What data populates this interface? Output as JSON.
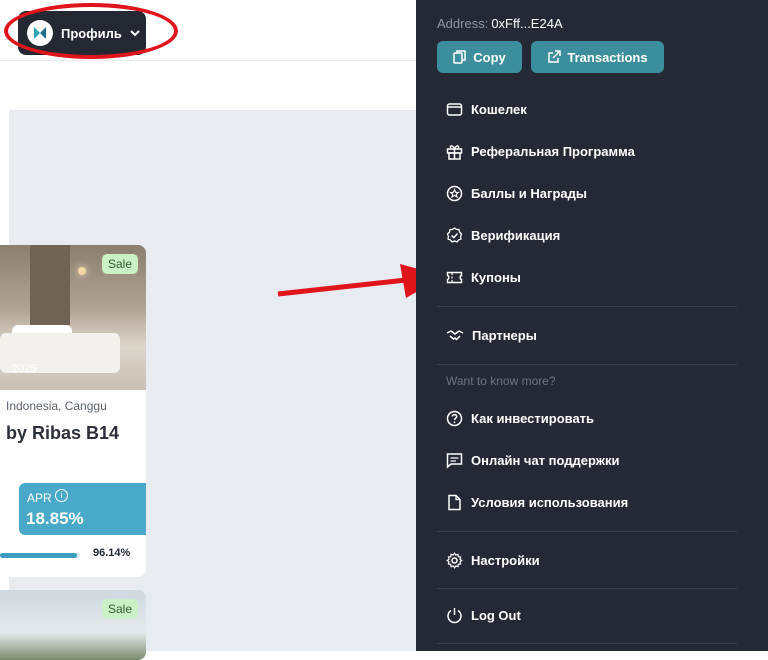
{
  "header": {
    "profile_label": "Профиль"
  },
  "card1": {
    "badge": "Sale",
    "year": "2025",
    "location": "Indonesia, Canggu",
    "title": "by Ribas B14",
    "apr_label": "APR",
    "apr_value": "18.85%",
    "progress_percent": 96.14,
    "progress_text": "96.14%"
  },
  "card2": {
    "badge": "Sale"
  },
  "menu": {
    "address_label": "Address:",
    "address_value": "0xFff...E24A",
    "copy_label": "Copy",
    "transactions_label": "Transactions",
    "items": [
      {
        "label": "Кошелек",
        "icon": "wallet-icon"
      },
      {
        "label": "Реферальная Программа",
        "icon": "gift-icon"
      },
      {
        "label": "Баллы и Награды",
        "icon": "badge-star-icon"
      },
      {
        "label": "Верификация",
        "icon": "verified-icon"
      },
      {
        "label": "Купоны",
        "icon": "ticket-icon"
      }
    ],
    "partners_label": "Партнеры",
    "know_more": "Want to know more?",
    "help_items": [
      {
        "label": "Как инвестировать",
        "icon": "question-icon"
      },
      {
        "label": "Онлайн чат поддержки",
        "icon": "chat-icon"
      },
      {
        "label": "Условия использования",
        "icon": "document-icon"
      }
    ],
    "settings_label": "Настройки",
    "logout_label": "Log Out"
  },
  "colors": {
    "menu_bg": "#252935",
    "teal_button": "#3d8e9c",
    "apr_blue": "#49a9c8",
    "annotation_red": "#e0141b"
  }
}
